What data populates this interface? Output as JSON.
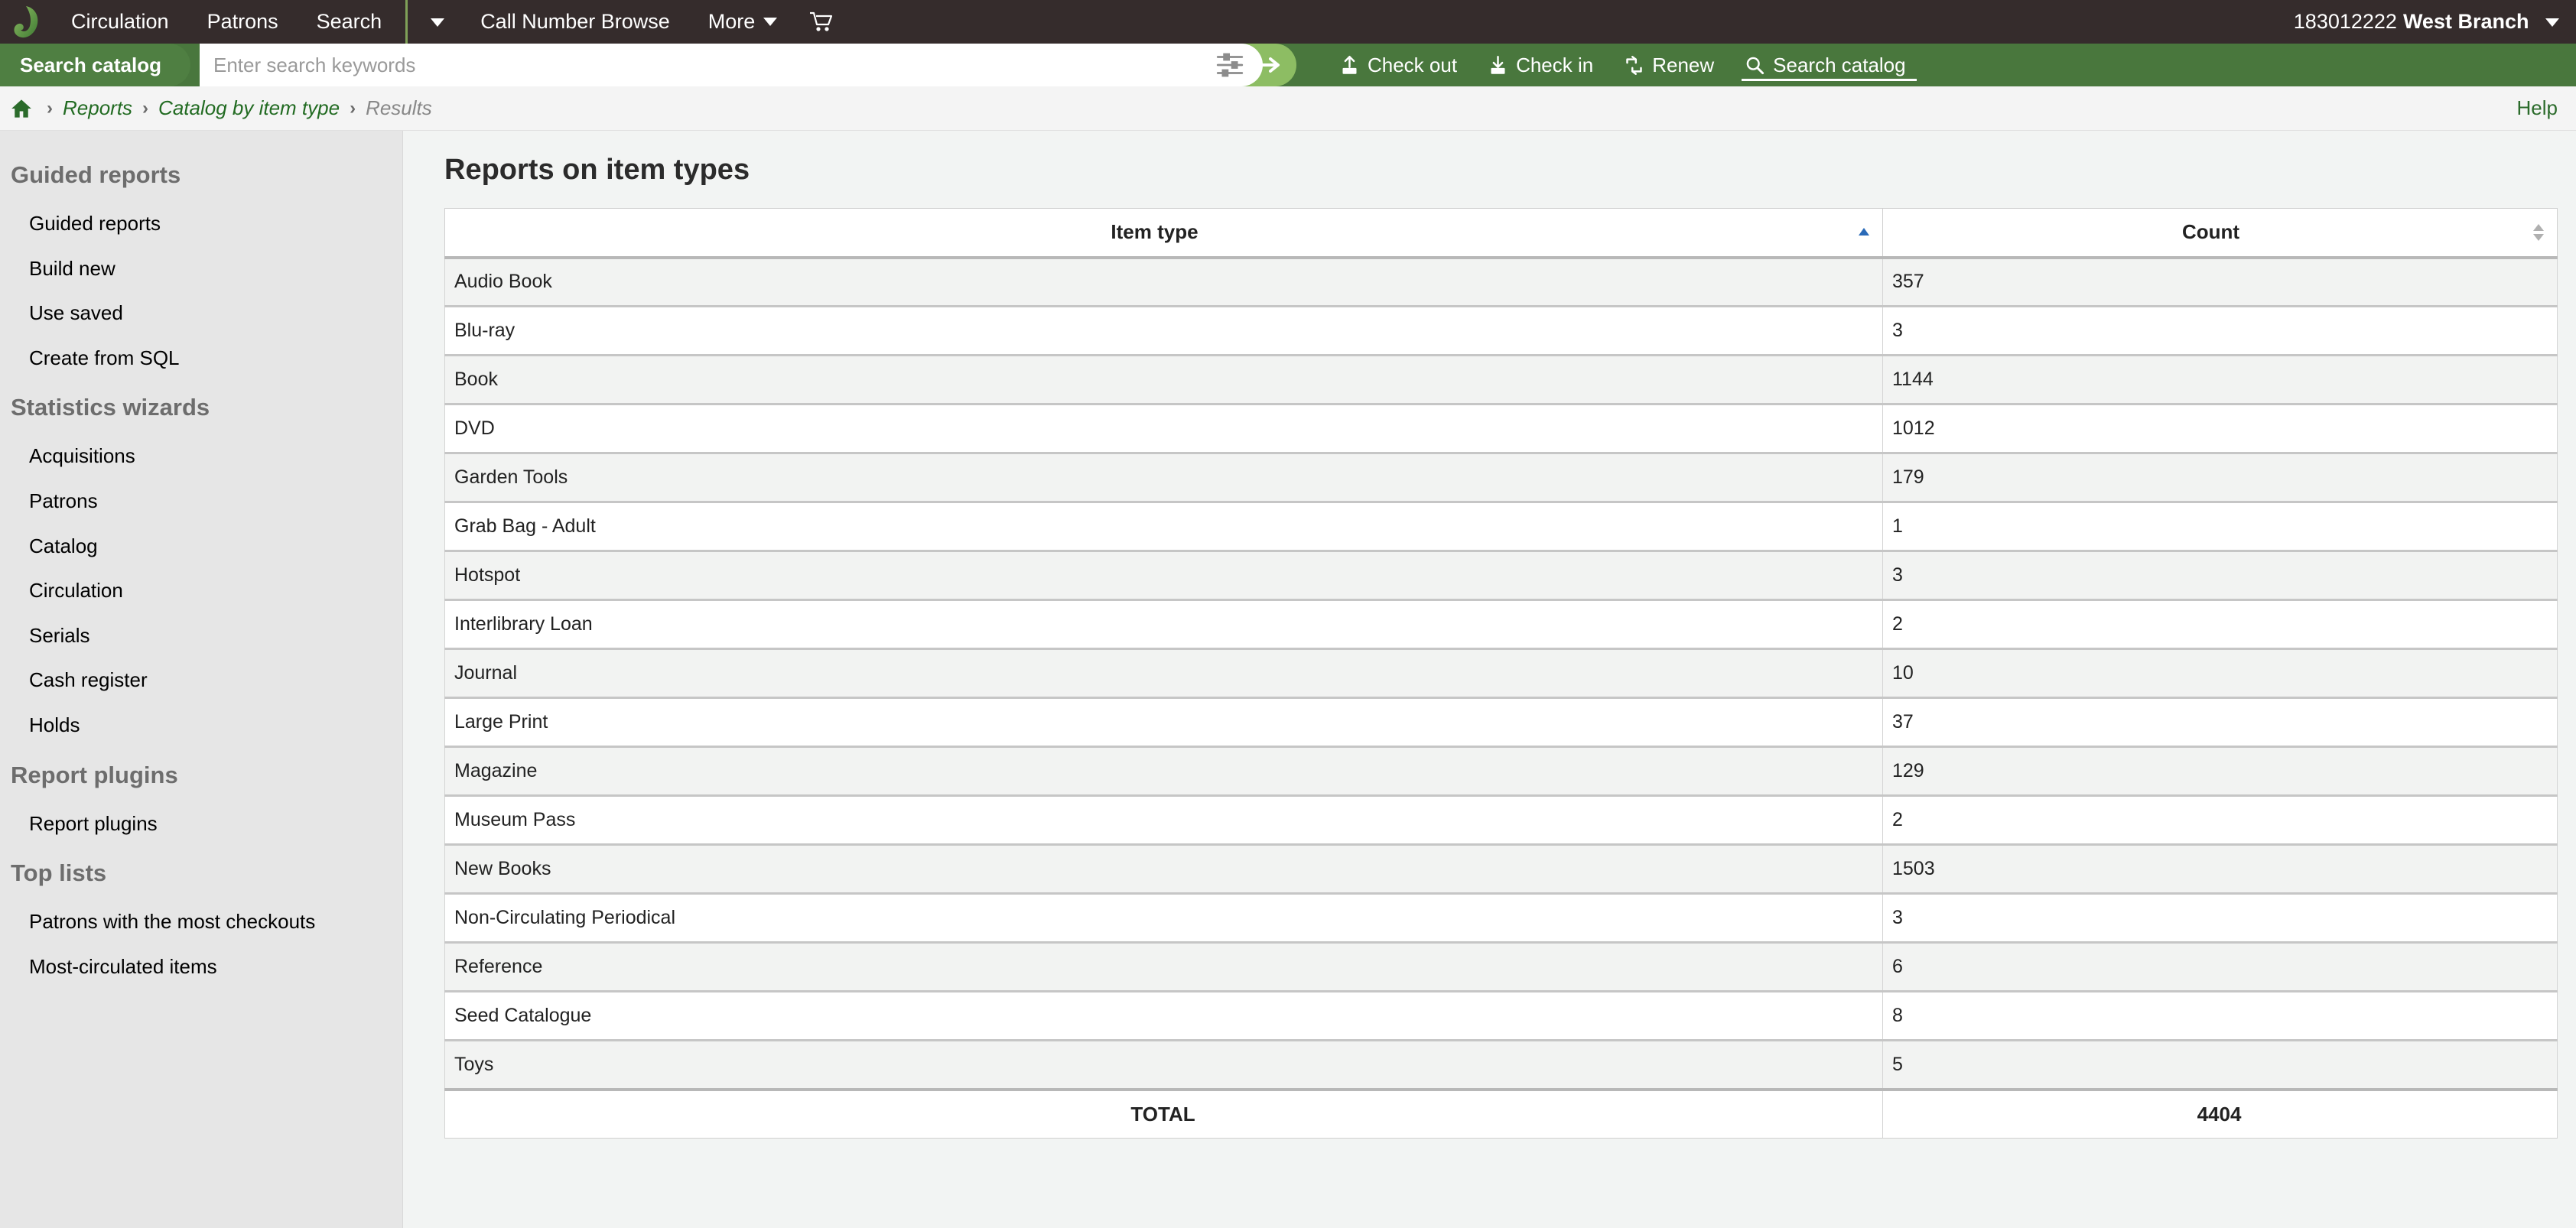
{
  "topnav": {
    "logo_icon": "koha-leaf-logo",
    "items": [
      {
        "label": "Circulation",
        "name": "nav-circulation"
      },
      {
        "label": "Patrons",
        "name": "nav-patrons"
      },
      {
        "label": "Search",
        "name": "nav-search"
      }
    ],
    "dropdown_caret_icon": "chevron-down-icon",
    "call_number_browse": "Call Number Browse",
    "more_label": "More",
    "cart_icon": "shopping-cart-icon",
    "branch_number": "183012222",
    "branch_name": "West Branch",
    "branch_caret_icon": "chevron-down-icon"
  },
  "searchbar": {
    "tab_label": "Search catalog",
    "placeholder": "Enter search keywords",
    "value": "",
    "filter_icon": "sliders-filter-icon",
    "submit_icon": "arrow-right-icon",
    "quick_links": [
      {
        "label": "Check out",
        "icon": "check-out-icon",
        "active": false
      },
      {
        "label": "Check in",
        "icon": "check-in-icon",
        "active": false
      },
      {
        "label": "Renew",
        "icon": "renew-icon",
        "active": false
      },
      {
        "label": "Search catalog",
        "icon": "search-icon",
        "active": true
      }
    ]
  },
  "breadcrumb": {
    "home_icon": "home-icon",
    "separator": "›",
    "items": [
      {
        "label": "Reports",
        "current": false
      },
      {
        "label": "Catalog by item type",
        "current": false
      },
      {
        "label": "Results",
        "current": true
      }
    ],
    "help_label": "Help"
  },
  "sidebar": {
    "sections": [
      {
        "heading": "Guided reports",
        "items": [
          "Guided reports",
          "Build new",
          "Use saved",
          "Create from SQL"
        ]
      },
      {
        "heading": "Statistics wizards",
        "items": [
          "Acquisitions",
          "Patrons",
          "Catalog",
          "Circulation",
          "Serials",
          "Cash register",
          "Holds"
        ]
      },
      {
        "heading": "Report plugins",
        "items": [
          "Report plugins"
        ]
      },
      {
        "heading": "Top lists",
        "items": [
          "Patrons with the most checkouts",
          "Most-circulated items"
        ]
      }
    ]
  },
  "main": {
    "title": "Reports on item types",
    "table": {
      "columns": [
        {
          "label": "Item type",
          "sort": "asc",
          "sort_icon": "sort-ascending-icon"
        },
        {
          "label": "Count",
          "sort": "none",
          "sort_icon": "sort-none-icon"
        }
      ],
      "rows": [
        {
          "item_type": "Audio Book",
          "count": "357"
        },
        {
          "item_type": "Blu-ray",
          "count": "3"
        },
        {
          "item_type": "Book",
          "count": "1144"
        },
        {
          "item_type": "DVD",
          "count": "1012"
        },
        {
          "item_type": "Garden Tools",
          "count": "179"
        },
        {
          "item_type": "Grab Bag - Adult",
          "count": "1"
        },
        {
          "item_type": "Hotspot",
          "count": "3"
        },
        {
          "item_type": "Interlibrary Loan",
          "count": "2"
        },
        {
          "item_type": "Journal",
          "count": "10"
        },
        {
          "item_type": "Large Print",
          "count": "37"
        },
        {
          "item_type": "Magazine",
          "count": "129"
        },
        {
          "item_type": "Museum Pass",
          "count": "2"
        },
        {
          "item_type": "New Books",
          "count": "1503"
        },
        {
          "item_type": "Non-Circulating Periodical",
          "count": "3"
        },
        {
          "item_type": "Reference",
          "count": "6"
        },
        {
          "item_type": "Seed Catalogue",
          "count": "8"
        },
        {
          "item_type": "Toys",
          "count": "5"
        }
      ],
      "total_label": "TOTAL",
      "total_value": "4404"
    }
  },
  "colors": {
    "topbar_bg": "#352c2c",
    "search_bg": "#49773d",
    "accent_green": "#8dbd63",
    "link_green": "#226b22",
    "sidebar_bg": "#e6e6e6",
    "sort_active": "#2a6ab8"
  }
}
